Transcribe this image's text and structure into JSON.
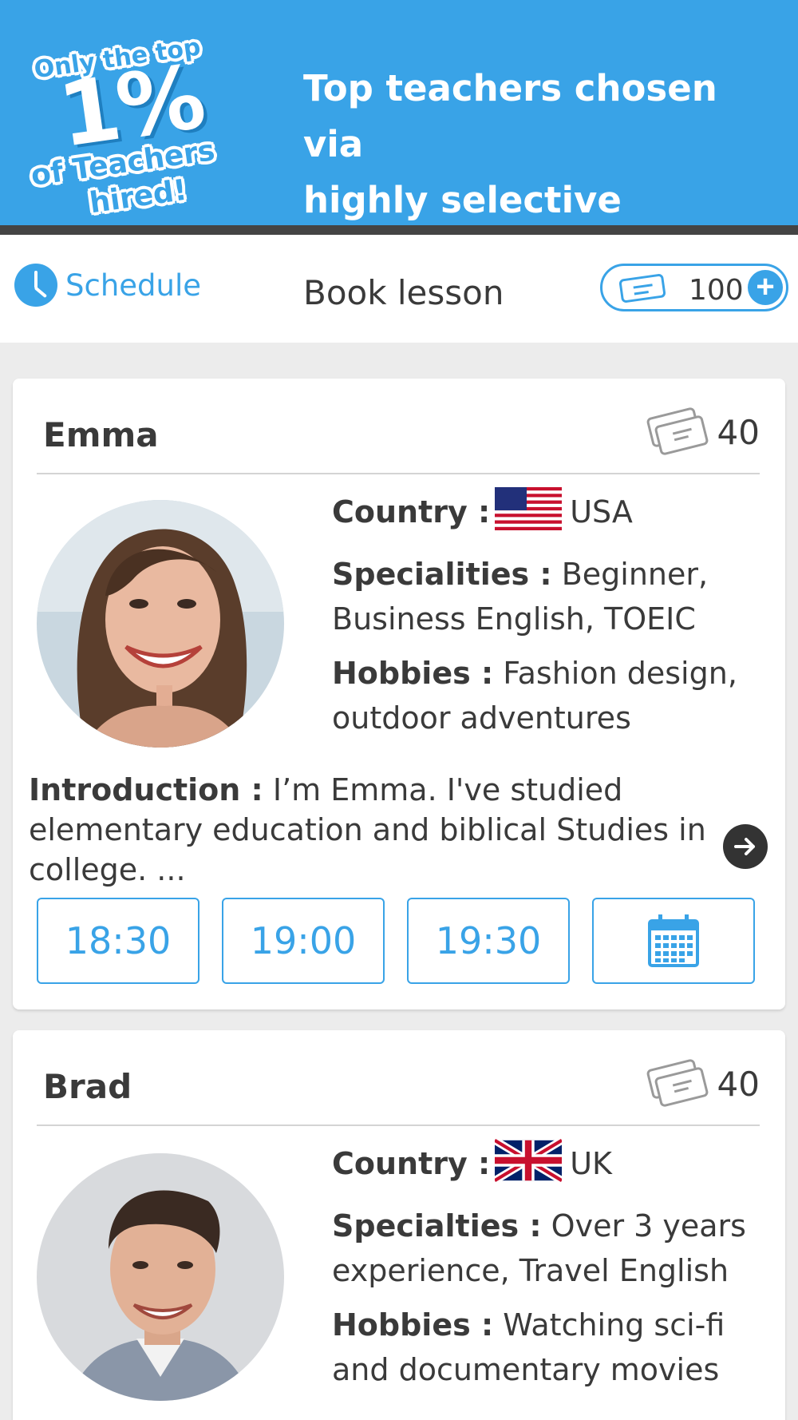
{
  "banner": {
    "badge_top": "Only the top",
    "badge_percent": "1%",
    "badge_mid": "of Teachers",
    "badge_bottom": "hired!",
    "headline_line1": "Top teachers chosen via",
    "headline_line2": "highly selective exams!"
  },
  "header": {
    "schedule_label": "Schedule",
    "title": "Book lesson",
    "ticket_balance": "100"
  },
  "teachers": [
    {
      "name": "Emma",
      "price": "40",
      "country_label": "Country :",
      "country": "USA",
      "specialities_label": "Specialities :",
      "specialities": "Beginner, Business English, TOEIC",
      "hobbies_label": "Hobbies :",
      "hobbies": "Fashion design, outdoor adventures",
      "intro_label": "Introduction :",
      "intro": "I’m Emma. I've studied elementary education and biblical Studies in college. ...",
      "slots": [
        "18:30",
        "19:00",
        "19:30"
      ]
    },
    {
      "name": "Brad",
      "price": "40",
      "country_label": "Country :",
      "country": "UK",
      "specialities_label": "Specialties :",
      "specialities": "Over 3 years experience, Travel English",
      "hobbies_label": "Hobbies :",
      "hobbies": "Watching sci-fi and documentary movies"
    }
  ],
  "colors": {
    "accent": "#39a3e7",
    "text": "#3a3a3a",
    "background": "#ececec"
  }
}
